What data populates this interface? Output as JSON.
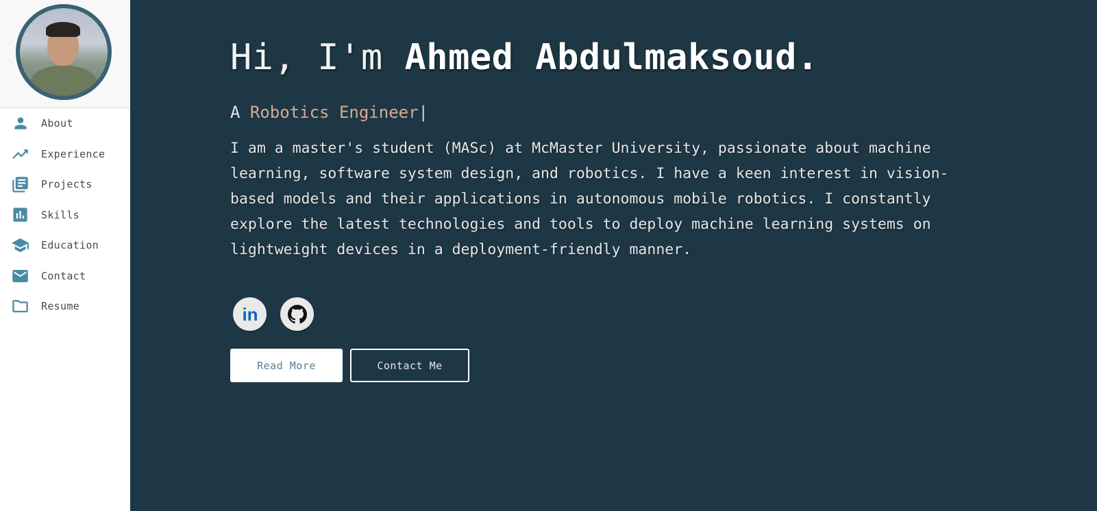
{
  "sidebar": {
    "avatar_alt": "Ahmed Abdulmaksoud",
    "items": [
      {
        "label": "About",
        "icon": "person-icon"
      },
      {
        "label": "Experience",
        "icon": "trending-up-icon"
      },
      {
        "label": "Projects",
        "icon": "library-books-icon"
      },
      {
        "label": "Skills",
        "icon": "bar-chart-icon"
      },
      {
        "label": "Education",
        "icon": "graduation-cap-icon"
      },
      {
        "label": "Contact",
        "icon": "mail-icon"
      },
      {
        "label": "Resume",
        "icon": "folder-icon"
      }
    ]
  },
  "hero": {
    "greeting": "Hi, I'm ",
    "name": "Ahmed Abdulmaksoud.",
    "tagline_prefix": "A ",
    "tagline_role": "Robotics Engineer",
    "tagline_cursor": "|",
    "bio": "I am a master's student (MASc) at McMaster University, passionate about machine learning, software system design, and robotics. I have a keen interest in vision-based models and their applications in autonomous mobile robotics. I constantly explore the latest technologies and tools to deploy machine learning systems on lightweight devices in a deployment-friendly manner.",
    "socials": [
      {
        "name": "LinkedIn",
        "icon": "linkedin-icon",
        "text": "in"
      },
      {
        "name": "GitHub",
        "icon": "github-icon"
      }
    ],
    "buttons": {
      "read_more": "Read More",
      "contact_me": "Contact Me"
    }
  },
  "colors": {
    "background": "#1e3744",
    "accent": "#4a8aa3",
    "role": "#d9a997",
    "linkedin": "#0a66c2"
  }
}
